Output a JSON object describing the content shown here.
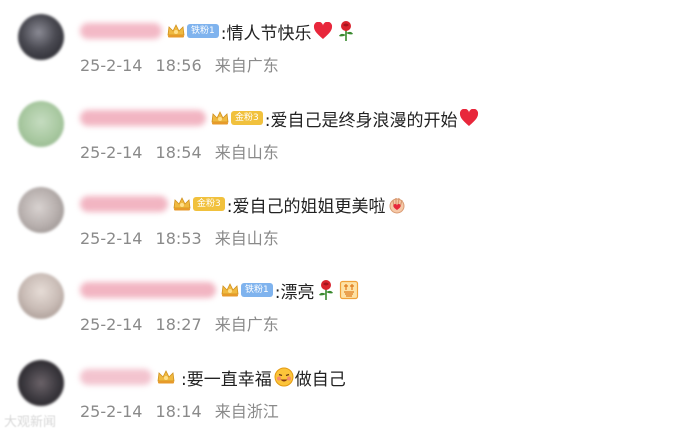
{
  "comments": [
    {
      "badge": "铁粉1",
      "badge_kind": "iron",
      "text": ":情人节快乐",
      "emojis": [
        "heart-icon",
        "rose-icon"
      ],
      "date": "25-2-14",
      "time": "18:56",
      "location": "来自广东",
      "avatar_color": "#4a4a52"
    },
    {
      "badge": "金粉3",
      "badge_kind": "gold",
      "text": ":爱自己是终身浪漫的开始",
      "emojis": [
        "heart-icon"
      ],
      "date": "25-2-14",
      "time": "18:54",
      "location": "来自山东",
      "avatar_color": "#a8c8a0"
    },
    {
      "badge": "金粉3",
      "badge_kind": "gold",
      "text": ":爱自己的姐姐更美啦",
      "emojis": [
        "hand-heart-icon"
      ],
      "date": "25-2-14",
      "time": "18:53",
      "location": "来自山东",
      "avatar_color": "#b8b0ae"
    },
    {
      "badge": "铁粉1",
      "badge_kind": "iron",
      "text": ":漂亮",
      "emojis": [
        "rose-icon",
        "praise-icon"
      ],
      "date": "25-2-14",
      "time": "18:27",
      "location": "来自广东",
      "avatar_color": "#c9bcb6"
    },
    {
      "badge": "",
      "badge_kind": "none",
      "text": ":要一直幸福",
      "text_after": "做自己",
      "emojis": [
        "smiling-face-icon"
      ],
      "date": "25-2-14",
      "time": "18:14",
      "location": "来自浙江",
      "avatar_color": "#3d3a40"
    }
  ],
  "watermark": "大观新闻",
  "colors": {
    "meta_text": "#8a8a8a",
    "iron_badge": "#7fb3ee",
    "gold_badge": "#f1c13d",
    "heart": "#e8273b"
  }
}
